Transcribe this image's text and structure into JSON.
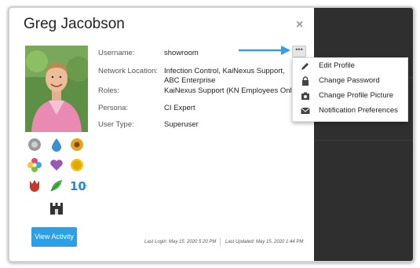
{
  "profile": {
    "name": "Greg Jacobson",
    "close_label": "×",
    "more_label": "•••",
    "fields": [
      {
        "label": "Username:",
        "value": "showroom"
      },
      {
        "label": "Network Location:",
        "value": "Infection Control, KaiNexus Support,",
        "value2": "ABC Enterprise"
      },
      {
        "label": "Roles:",
        "value": "KaiNexus Support (KN Employees Only)"
      },
      {
        "label": "Persona:",
        "value": "CI Expert"
      },
      {
        "label": "User Type:",
        "value": "Superuser"
      }
    ],
    "badges": [
      "gear-badge-icon",
      "water-drop-badge-icon",
      "sunflower-badge-icon",
      "flower-badge-icon",
      "heart-badge-icon",
      "coin-badge-icon",
      "tulip-badge-icon",
      "leaf-badge-icon",
      "hundred-badge-icon",
      "castle-badge-icon"
    ],
    "view_activity_label": "View Activity",
    "last_login": "Last Login: May 15, 2020 5:20 PM",
    "last_updated": "Last Updated: May 15, 2020 1:44 PM"
  },
  "menu": {
    "items": [
      {
        "label": "Edit Profile",
        "icon": "pencil-icon"
      },
      {
        "label": "Change Password",
        "icon": "lock-icon"
      },
      {
        "label": "Change Profile Picture",
        "icon": "camera-icon"
      },
      {
        "label": "Notification Preferences",
        "icon": "envelope-icon"
      }
    ]
  },
  "colors": {
    "accent": "#2d9fe6",
    "arrow": "#3a9be0",
    "backdrop": "#2f2f2f"
  }
}
